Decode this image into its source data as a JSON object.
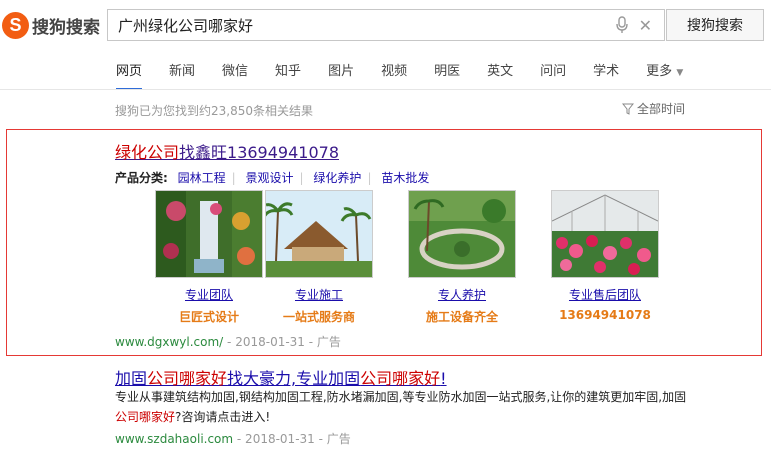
{
  "header": {
    "logo_text": "搜狗搜索",
    "search_value": "广州绿化公司哪家好",
    "search_button": "搜狗搜索"
  },
  "nav": {
    "items": [
      "网页",
      "新闻",
      "微信",
      "知乎",
      "图片",
      "视频",
      "明医",
      "英文",
      "问问",
      "学术",
      "更多"
    ],
    "active": "网页"
  },
  "results_info": {
    "count_text": "搜狗已为您找到约23,850条相关结果",
    "time_filter": "全部时间"
  },
  "ad": {
    "title_pre": "绿化公司",
    "title_rest": "找鑫旺13694941078",
    "category_label": "产品分类:",
    "categories": [
      "园林工程",
      "景观设计",
      "绿化养护",
      "苗木批发"
    ],
    "tiles": [
      {
        "link": "专业团队",
        "sub": "巨匠式设计",
        "image": "vertical-garden-waterfall-photo"
      },
      {
        "link": "专业施工",
        "sub": "一站式服务商",
        "image": "palm-resort-building-photo"
      },
      {
        "link": "专人养护",
        "sub": "施工设备齐全",
        "image": "landscaped-garden-photo"
      },
      {
        "link": "专业售后团队",
        "sub": "13694941078",
        "image": "greenhouse-flowers-photo"
      }
    ],
    "url": "www.dgxwyl.com/",
    "date": " - 2018-01-31 - ",
    "ad_label": "广告"
  },
  "result2": {
    "title_parts": [
      "加固",
      "公司哪家好",
      "找大豪力,专业加固",
      "公司哪家好",
      "!"
    ],
    "desc_parts": [
      "专业从事建筑结构加固,钢结构加固工程,防水堵漏加固,等专业防水加固一站式服务,让你的建筑更加牢固,加固",
      "公司哪家好",
      "?咨询请点击进入!"
    ],
    "url": "www.szdahaoli.com",
    "date": " - 2018-01-31 - ",
    "ad_label": "广告"
  },
  "colors": {
    "brand": "#f25d12",
    "link": "#1a0dab",
    "highlight": "#c00000",
    "url_green": "#2b8a3e",
    "tile_sub_orange": "#e57b17",
    "ad_border": "#e53935"
  }
}
